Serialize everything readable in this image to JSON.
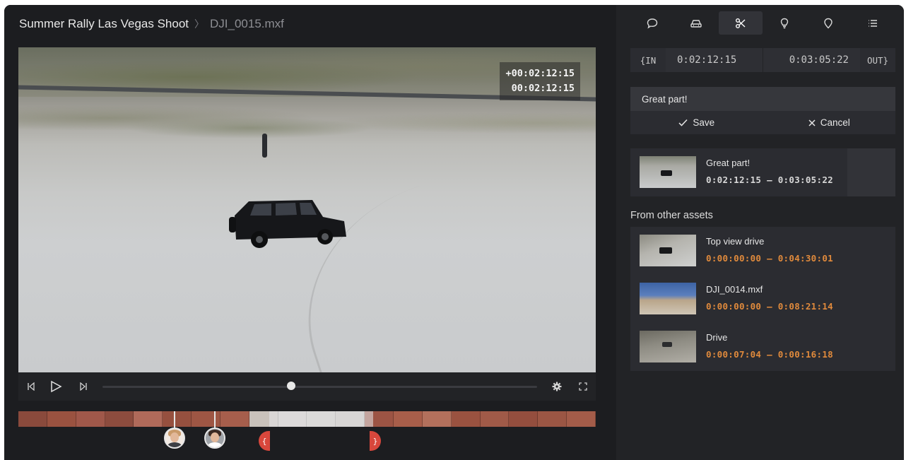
{
  "breadcrumb": {
    "project": "Summer Rally Las Vegas Shoot",
    "separator": "〉",
    "file": "DJI_0015.mxf"
  },
  "video": {
    "timecode_offset": "+00:02:12:15",
    "timecode": "00:02:12:15",
    "playhead_fraction": 0.43
  },
  "controls": {
    "prev_icon": "skip-back-icon",
    "play_icon": "play-icon",
    "next_icon": "skip-forward-icon",
    "settings_icon": "gear-icon",
    "fullscreen_icon": "fullscreen-icon"
  },
  "timeline": {
    "in_marker": "{",
    "out_marker": "}"
  },
  "toolbar": {
    "tools": [
      "comment-icon",
      "car-icon",
      "scissors-icon",
      "lightbulb-icon",
      "location-pin-icon",
      "list-icon"
    ],
    "active": 2
  },
  "inout": {
    "in_label": "{IN",
    "in_value": "0:02:12:15",
    "out_value": "0:03:05:22",
    "out_label": "OUT}"
  },
  "editor": {
    "comment_value": "Great part!",
    "save_label": "Save",
    "cancel_label": "Cancel"
  },
  "current_clip": {
    "name": "Great part!",
    "range": "0:02:12:15 – 0:03:05:22"
  },
  "other_assets": {
    "title": "From other assets",
    "items": [
      {
        "name": "Top view drive",
        "range": "0:00:00:00 – 0:04:30:01"
      },
      {
        "name": "DJI_0014.mxf",
        "range": "0:00:00:00 – 0:08:21:14"
      },
      {
        "name": "Drive",
        "range": "0:00:07:04 – 0:00:16:18"
      }
    ]
  },
  "colors": {
    "accent_orange": "#e08a3c",
    "marker_red": "#d8473c",
    "panel_bg": "#222326",
    "app_bg": "#1c1d20"
  }
}
